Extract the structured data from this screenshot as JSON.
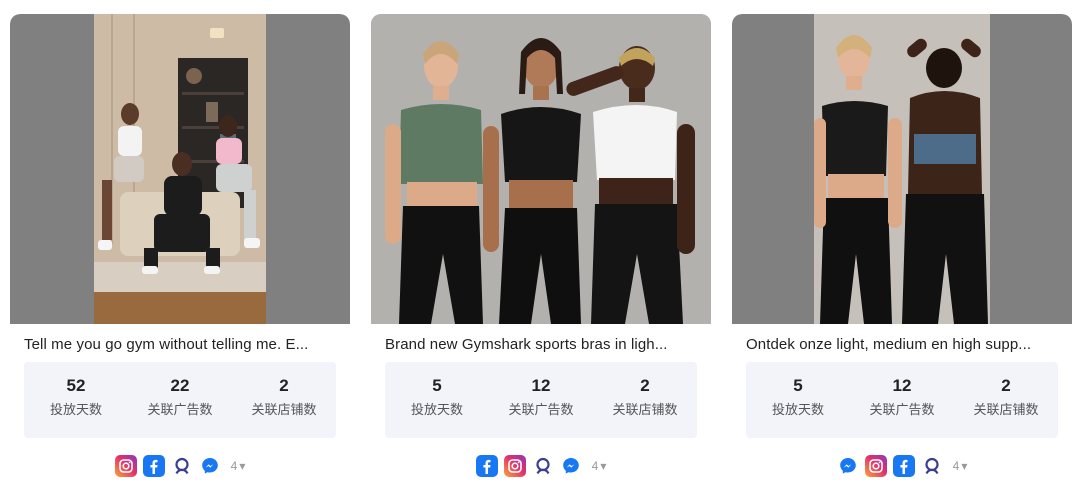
{
  "cards": [
    {
      "title": "Tell me you go gym without telling me. E...",
      "stats": [
        {
          "value": "52",
          "label": "投放天数"
        },
        {
          "value": "22",
          "label": "关联广告数"
        },
        {
          "value": "2",
          "label": "关联店铺数"
        }
      ],
      "platforms": [
        "instagram-icon",
        "facebook-icon",
        "audience-network-icon",
        "messenger-icon"
      ],
      "more_count": "4"
    },
    {
      "title": "Brand new Gymshark sports bras in ligh...",
      "stats": [
        {
          "value": "5",
          "label": "投放天数"
        },
        {
          "value": "12",
          "label": "关联广告数"
        },
        {
          "value": "2",
          "label": "关联店铺数"
        }
      ],
      "platforms": [
        "facebook-icon",
        "instagram-icon",
        "audience-network-icon",
        "messenger-icon"
      ],
      "more_count": "4"
    },
    {
      "title": "Ontdek onze light, medium en high supp...",
      "stats": [
        {
          "value": "5",
          "label": "投放天数"
        },
        {
          "value": "12",
          "label": "关联广告数"
        },
        {
          "value": "2",
          "label": "关联店铺数"
        }
      ],
      "platforms": [
        "messenger-icon",
        "instagram-icon",
        "facebook-icon",
        "audience-network-icon"
      ],
      "more_count": "4"
    }
  ],
  "colors": {
    "stats_bg": "#f2f4fa",
    "media_letterbox": "#808080",
    "facebook": "#1877f2",
    "messenger": "#1877f2",
    "audience_network": "#3b3f8f"
  }
}
